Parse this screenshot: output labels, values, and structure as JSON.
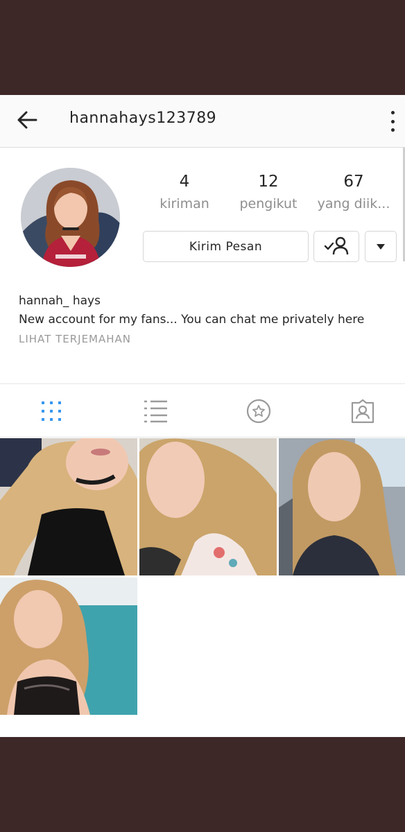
{
  "header": {
    "username": "hannahays123789",
    "back_icon": "arrow-left-icon",
    "more_icon": "more-vertical-icon"
  },
  "stats": [
    {
      "value": "4",
      "label": "kiriman"
    },
    {
      "value": "12",
      "label": "pengikut"
    },
    {
      "value": "67",
      "label": "yang diik..."
    }
  ],
  "buttons": {
    "message_label": "Kirim Pesan",
    "following_icon": "user-check-icon",
    "dropdown_icon": "caret-down-icon"
  },
  "bio": {
    "name": "hannah_ hays",
    "text": "New account for my fans...  You can chat me privately here",
    "translate_link": "LIHAT TERJEMAHAN"
  },
  "tabs": [
    {
      "icon": "grid-icon",
      "active": true
    },
    {
      "icon": "list-icon",
      "active": false
    },
    {
      "icon": "star-badge-icon",
      "active": false
    },
    {
      "icon": "tagged-photos-icon",
      "active": false
    }
  ],
  "colors": {
    "accent": "#3897f0",
    "background": "#3d2727",
    "text": "#262626",
    "secondary_text": "#8e8e8e"
  },
  "photos": [
    {
      "name": "photo-1"
    },
    {
      "name": "photo-2"
    },
    {
      "name": "photo-3"
    },
    {
      "name": "photo-4"
    }
  ]
}
